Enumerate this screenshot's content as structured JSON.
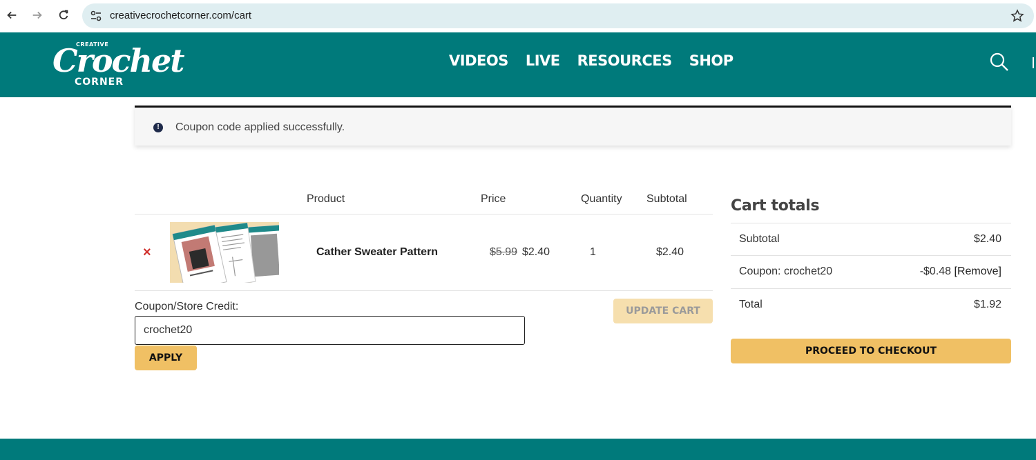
{
  "browser": {
    "url": "creativecrochetcorner.com/cart",
    "icons": [
      "back-arrow-icon",
      "forward-arrow-icon",
      "reload-icon",
      "site-settings-icon",
      "bookmark-star-icon"
    ]
  },
  "header": {
    "logo": {
      "top": "CREATIVE",
      "main": "Crochet",
      "bottom": "CORNER"
    },
    "nav": [
      "VIDEOS",
      "LIVE",
      "RESOURCES",
      "SHOP"
    ],
    "bg_color": "#007a7b"
  },
  "notice": {
    "text": "Coupon code applied successfully."
  },
  "cart": {
    "columns": {
      "product": "Product",
      "price": "Price",
      "quantity": "Quantity",
      "subtotal": "Subtotal"
    },
    "items": [
      {
        "remove": "×",
        "name": "Cather Sweater Pattern",
        "price_old": "$5.99",
        "price_new": "$2.40",
        "quantity": "1",
        "subtotal": "$2.40"
      }
    ],
    "coupon_label": "Coupon/Store Credit:",
    "coupon_value": "crochet20",
    "apply_label": "APPLY",
    "update_label": "UPDATE CART"
  },
  "totals": {
    "title": "Cart totals",
    "subtotal_label": "Subtotal",
    "subtotal_value": "$2.40",
    "coupon_label": "Coupon: crochet20",
    "coupon_value": "-$0.48",
    "coupon_remove": "[Remove]",
    "total_label": "Total",
    "total_value": "$1.92",
    "checkout_label": "PROCEED TO CHECKOUT"
  },
  "colors": {
    "accent": "#f0c064",
    "teal": "#007a7b",
    "remove_red": "#d0302c"
  }
}
